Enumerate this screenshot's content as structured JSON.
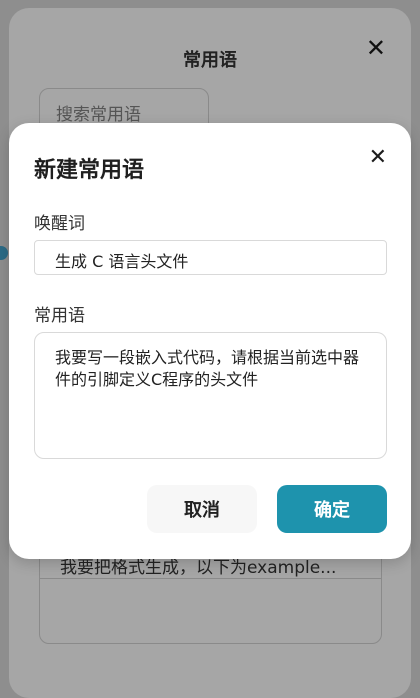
{
  "background": {
    "title": "常用语",
    "search_placeholder": "搜索常用语",
    "list_items": [
      "我要把格式生成，以下为example..."
    ]
  },
  "modal": {
    "title": "新建常用语",
    "wake_word_label": "唤醒词",
    "wake_word_value": "生成 C 语言头文件",
    "phrase_label": "常用语",
    "phrase_value": "我要写一段嵌入式代码，请根据当前选中器件的引脚定义C程序的头文件",
    "cancel_label": "取消",
    "confirm_label": "确定"
  },
  "colors": {
    "accent": "#1e93ad",
    "overlay": "#8e8e8e"
  },
  "icons": {
    "close": "close-icon"
  }
}
